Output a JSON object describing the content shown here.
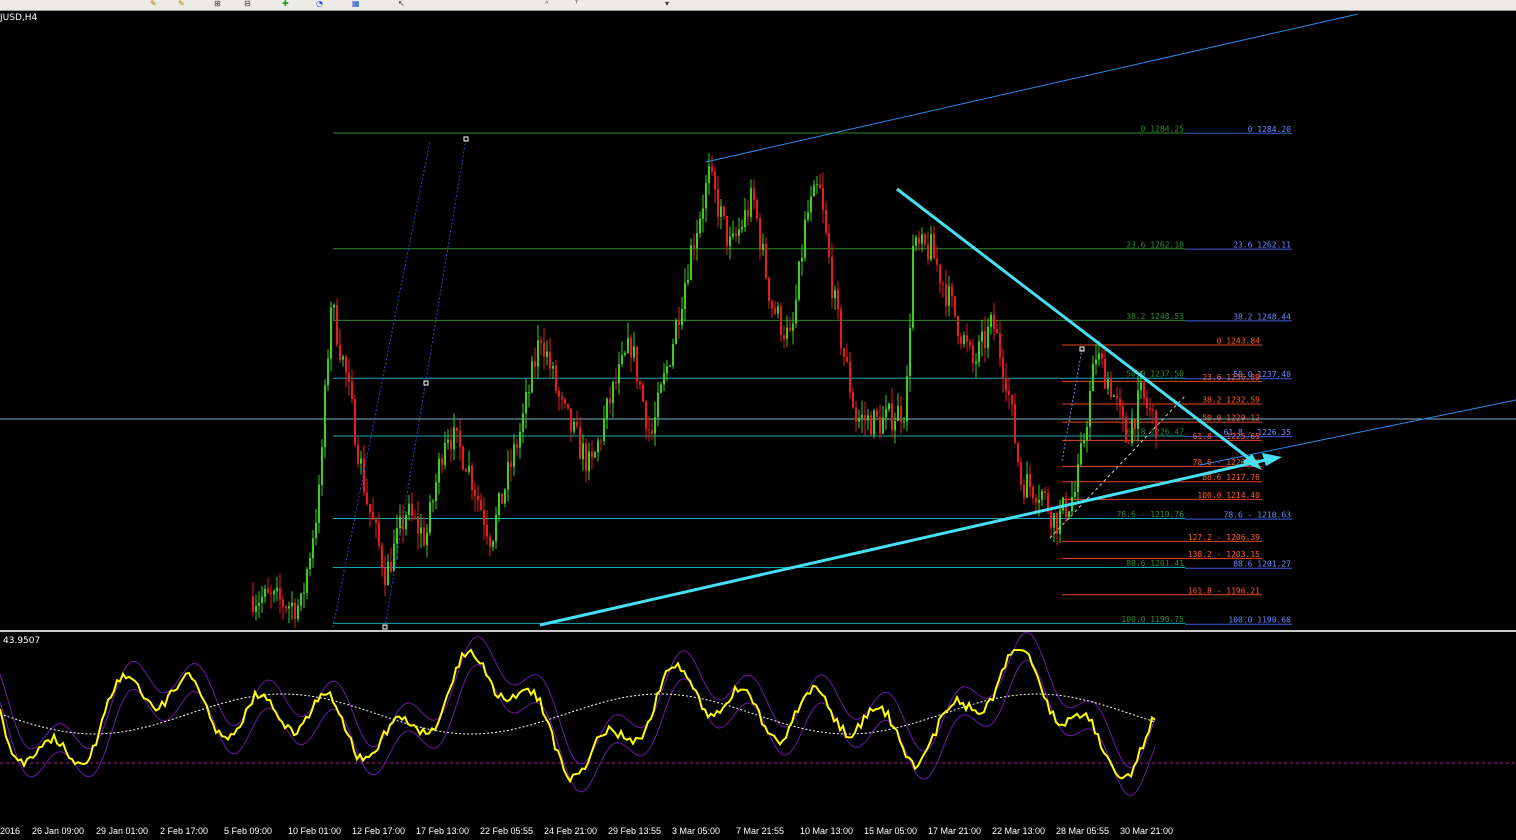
{
  "chart": {
    "symbol": "JUSD,H4",
    "oscillator_value": "43.9507"
  },
  "colors": {
    "bull": "#39d11a",
    "bear": "#e81a1a",
    "trend": "#46e0f2",
    "channel": "#2a8ae8",
    "fib_green": "#2e8a2e",
    "fib_blue": "#3a5cd8",
    "fib_red": "#e8461e",
    "osc_main": "#ffff00",
    "osc_band": "#6a1aa8"
  },
  "fib_green_levels": [
    {
      "label": "0 1284.25",
      "price": 1284.25
    },
    {
      "label": "23.6 1262.18",
      "price": 1262.18
    },
    {
      "label": "38.2 1248.53",
      "price": 1248.53
    },
    {
      "label": "50.0 1237.50",
      "price": 1237.5
    },
    {
      "label": "61.8 1226.47",
      "price": 1226.47
    },
    {
      "label": "78.6 - 1210.76",
      "price": 1210.76
    },
    {
      "label": "88.6 1201.41",
      "price": 1201.41
    },
    {
      "label": "100.0 1190.75",
      "price": 1190.75
    }
  ],
  "fib_blue_levels": [
    {
      "label": "0 1284.20",
      "price": 1284.2
    },
    {
      "label": "23.6 1262.11",
      "price": 1262.11
    },
    {
      "label": "38.2 1248.44",
      "price": 1248.44
    },
    {
      "label": "50.0 1237.40",
      "price": 1237.4
    },
    {
      "label": "61.8 - 1226.35",
      "price": 1226.35
    },
    {
      "label": "78.6 - 1210.63",
      "price": 1210.63
    },
    {
      "label": "88.6 1201.27",
      "price": 1201.27
    },
    {
      "label": "100.0 1190.60",
      "price": 1190.6
    }
  ],
  "fib_red_levels": [
    {
      "label": "0 1243.84",
      "price": 1243.84
    },
    {
      "label": "23.6 1236.89",
      "price": 1236.89
    },
    {
      "label": "38.2 1232.59",
      "price": 1232.59
    },
    {
      "label": "50.0 1229.12",
      "price": 1229.12
    },
    {
      "label": "61.8 - 1225.65",
      "price": 1225.65
    },
    {
      "label": "78.6 - 1220.70",
      "price": 1220.7
    },
    {
      "label": "88.6 1217.76",
      "price": 1217.76
    },
    {
      "label": "100.0 1214.40",
      "price": 1214.4
    },
    {
      "label": "127.2 - 1206.39",
      "price": 1206.39
    },
    {
      "label": "138.2 - 1203.15",
      "price": 1203.15
    },
    {
      "label": "161.8 - 1196.21",
      "price": 1196.21
    }
  ],
  "time_axis": [
    "2016",
    "26 Jan 09:00",
    "29 Jan 01:00",
    "2 Feb 17:00",
    "5 Feb 09:00",
    "10 Feb 01:00",
    "12 Feb 17:00",
    "17 Feb 13:00",
    "22 Feb 05:55",
    "24 Feb 21:00",
    "29 Feb 13:55",
    "3 Mar 05:00",
    "7 Mar 21:55",
    "10 Mar 13:00",
    "15 Mar 05:00",
    "17 Mar 21:00",
    "22 Mar 13:00",
    "28 Mar 05:55",
    "30 Mar 21:00"
  ]
}
